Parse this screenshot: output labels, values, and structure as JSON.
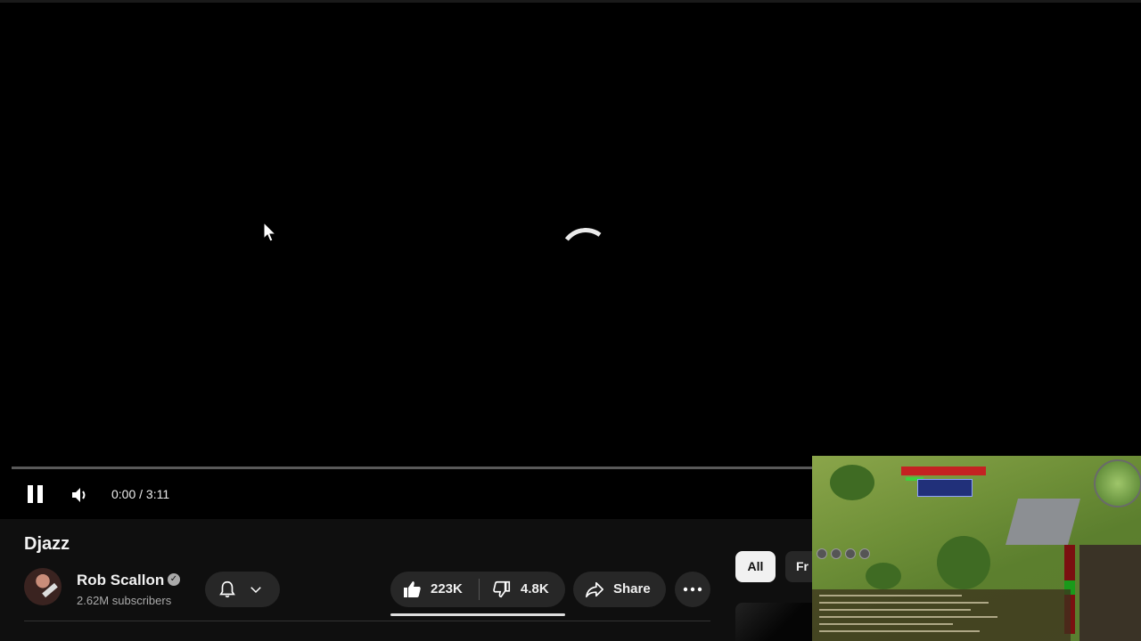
{
  "player": {
    "current_time": "0:00",
    "time_separator": " / ",
    "duration": "3:11",
    "state": "loading",
    "progress_fraction": 0
  },
  "video": {
    "title": "Djazz",
    "channel_name": "Rob Scallon",
    "subscribers": "2.62M subscribers",
    "likes": "223K",
    "dislikes": "4.8K",
    "share_label": "Share"
  },
  "chips": {
    "all_label": "All",
    "next_label": "Fr"
  },
  "icons": {
    "pause": "pause-icon",
    "volume": "volume-icon",
    "bell": "bell-icon",
    "chevron": "chevron-down-icon",
    "like": "thumbs-up-icon",
    "dislike": "thumbs-down-icon",
    "share": "share-icon",
    "more": "more-horizontal-icon",
    "verified": "verified-icon"
  },
  "colors": {
    "background": "#0f0f0f",
    "pill": "#272727",
    "chip_active": "#f1f1f1"
  }
}
